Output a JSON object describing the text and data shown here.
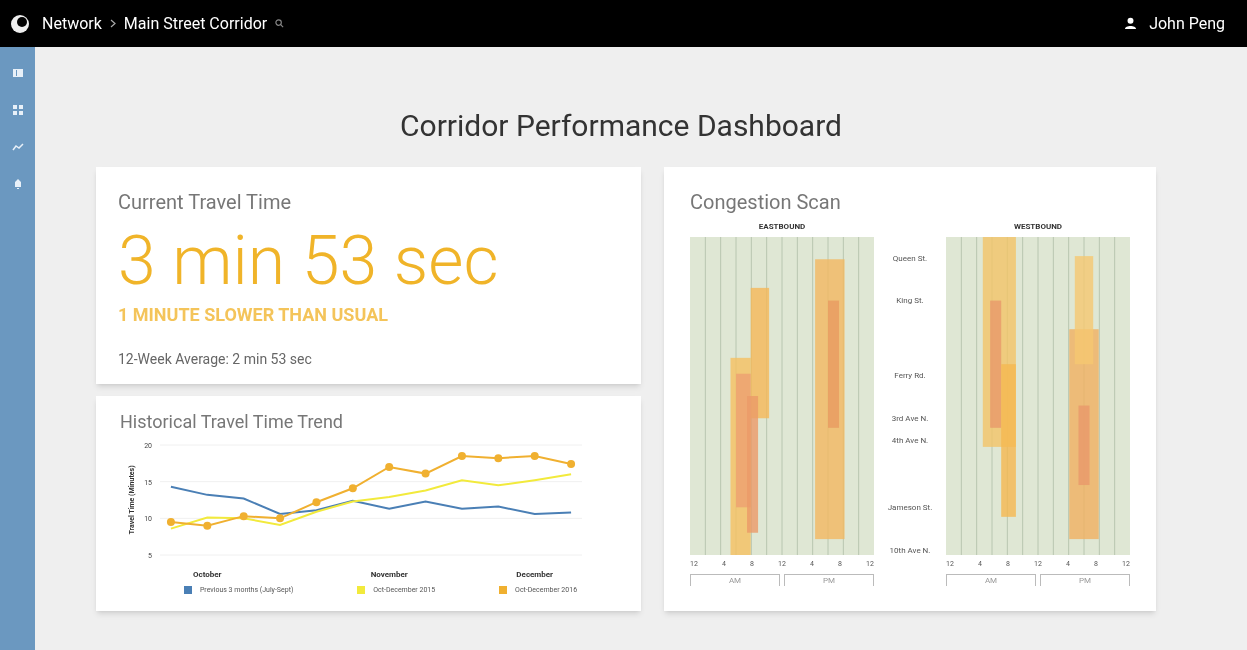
{
  "topbar": {
    "breadcrumb": [
      "Network",
      "Main Street Corridor"
    ],
    "user": "John Peng"
  },
  "sidebar": {
    "items": [
      {
        "kind": "panel"
      },
      {
        "kind": "grid"
      },
      {
        "kind": "trend"
      },
      {
        "kind": "bell"
      }
    ]
  },
  "page_title": "Corridor Performance Dashboard",
  "current_travel_time": {
    "title": "Current Travel Time",
    "value": "3 min 53 sec",
    "status": "1 MINUTE SLOWER THAN USUAL",
    "average": "12-Week Average: 2 min 53 sec"
  },
  "trend": {
    "title": "Historical Travel Time Trend",
    "chart_data": {
      "type": "line",
      "ylabel": "Travel Time (Minutes)",
      "categories": [
        null,
        "October",
        null,
        null,
        null,
        null,
        "November",
        null,
        null,
        null,
        "December",
        null
      ],
      "ylim": [
        5,
        20
      ],
      "yticks": [
        5,
        10,
        15,
        20
      ],
      "legend": "bottom",
      "series": [
        {
          "name": "Previous 3 months (July-Sept)",
          "color": "#4a7fb5",
          "values": [
            14.3,
            13.2,
            12.7,
            10.6,
            11.1,
            12.4,
            11.3,
            12.3,
            11.3,
            11.6,
            10.6,
            10.8
          ]
        },
        {
          "name": "Oct-December 2015",
          "color": "#f2ea3c",
          "values": [
            8.6,
            10.1,
            10.0,
            9.1,
            10.9,
            12.3,
            12.9,
            13.8,
            15.2,
            14.5,
            15.2,
            16.0
          ]
        },
        {
          "name": "Oct-December 2016",
          "color": "#f0b030",
          "marker": "circle",
          "values": [
            9.5,
            9.0,
            10.3,
            10.0,
            12.2,
            14.1,
            17.0,
            16.1,
            18.5,
            18.2,
            18.5,
            17.4
          ]
        }
      ]
    }
  },
  "congestion_scan": {
    "title": "Congestion Scan",
    "directions": [
      {
        "label": "EASTBOUND",
        "x_ticks": [
          "12",
          "4",
          "8",
          "12",
          "4",
          "8",
          "12"
        ],
        "periods": [
          "AM",
          "PM"
        ]
      },
      {
        "label": "WESTBOUND",
        "x_ticks": [
          "12",
          "4",
          "8",
          "12",
          "4",
          "8",
          "12"
        ],
        "periods": [
          "AM",
          "PM"
        ]
      }
    ],
    "streets": [
      "Queen St.",
      "King St.",
      "Ferry Rd.",
      "3rd Ave N.",
      "4th Ave N.",
      "Jameson St.",
      "10th Ave N."
    ]
  }
}
